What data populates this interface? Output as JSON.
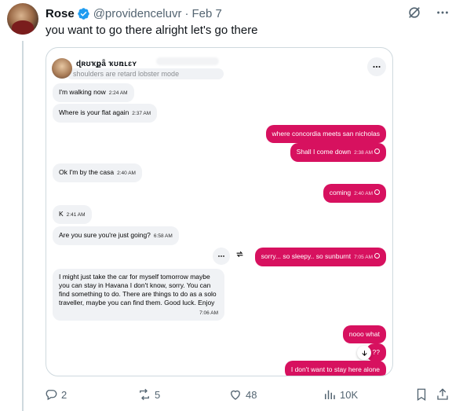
{
  "tweet": {
    "name": "Rose",
    "handle": "@providenceluvr",
    "date": "Feb 7",
    "text": "you want to go there alright let's go there"
  },
  "chat": {
    "contact_name": "ɖʀʊҡքǟ ҡʊռʟɛʏ",
    "contact_sub": "shoulders are retard lobster mode",
    "messages": [
      {
        "dir": "in",
        "text": "I'm walking now",
        "time": "2:24 AM"
      },
      {
        "dir": "in",
        "text": "Where is your flat again",
        "time": "2:37 AM"
      },
      {
        "dir": "out",
        "text": "where concordia meets san nicholas",
        "time": ""
      },
      {
        "dir": "out",
        "text": "Shall I come down",
        "time": "2:38 AM"
      },
      {
        "dir": "in",
        "text": "Ok I'm by the casa",
        "time": "2:40 AM"
      },
      {
        "dir": "out",
        "text": "coming",
        "time": "2:40 AM"
      },
      {
        "dir": "in",
        "text": "K",
        "time": "2:41 AM"
      },
      {
        "dir": "in",
        "text": "Are you sure you're just going?",
        "time": "6:58 AM"
      },
      {
        "dir": "out",
        "text": "sorry... so sleepy.. so sunburnt",
        "time": "7:05 AM"
      },
      {
        "dir": "in",
        "text": "I might just take the car for myself tomorrow maybe you can stay in Havana I don't know, sorry. You can find something to do. There are things to do as a solo traveller, maybe you can find them. Good luck. Enjoy",
        "time": "7:06 AM"
      },
      {
        "dir": "out",
        "text": "nooo what",
        "time": ""
      },
      {
        "dir": "out",
        "text": "??",
        "time": ""
      },
      {
        "dir": "out",
        "text": "I don't want to stay here alone",
        "time": ""
      }
    ]
  },
  "actions": {
    "replies": "2",
    "reposts": "5",
    "likes": "48",
    "views": "10K"
  },
  "colors": {
    "accent": "#d7115f",
    "verified": "#1d9bf0",
    "muted": "#536471"
  }
}
